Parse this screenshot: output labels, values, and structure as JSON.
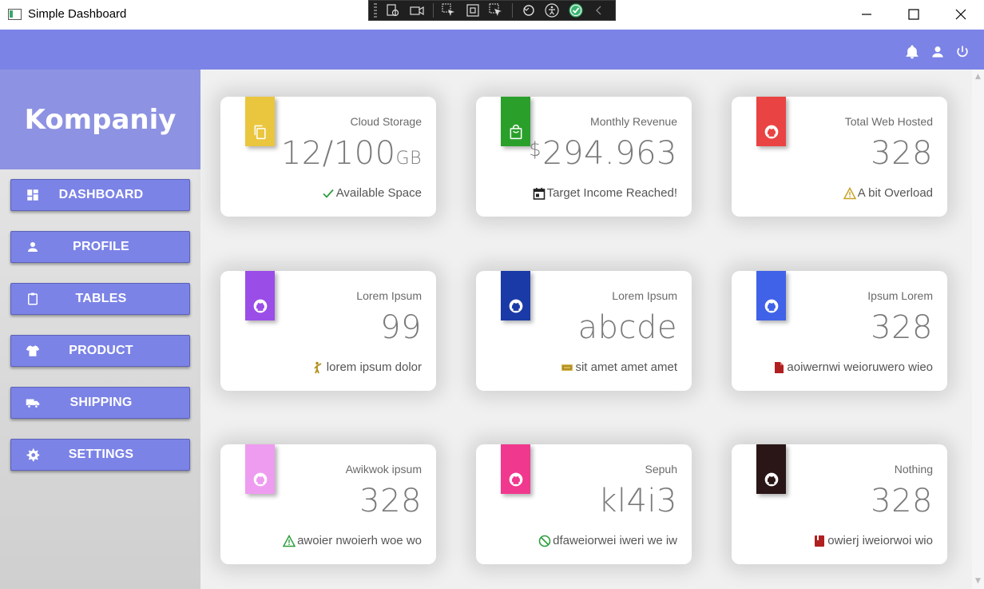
{
  "window": {
    "title": "Simple Dashboard"
  },
  "header": {
    "icons": [
      "bell-icon",
      "user-icon",
      "power-icon"
    ],
    "color": "#7b83e6"
  },
  "sidebar": {
    "brand": "Kompaniy",
    "items": [
      {
        "label": "DASHBOARD",
        "icon": "dashboard-icon"
      },
      {
        "label": "PROFILE",
        "icon": "person-icon"
      },
      {
        "label": "TABLES",
        "icon": "clipboard-icon"
      },
      {
        "label": "PRODUCT",
        "icon": "tshirt-icon"
      },
      {
        "label": "SHIPPING",
        "icon": "truck-icon"
      },
      {
        "label": "SETTINGS",
        "icon": "gear-icon"
      }
    ]
  },
  "cards": [
    {
      "title": "Cloud Storage",
      "value": "12/100",
      "unit": "GB",
      "footer": "Available Space",
      "tab_color": "#eac63f",
      "icon": "copy-icon",
      "footer_icon": "check-icon",
      "footer_icon_color": "#2e9e3e"
    },
    {
      "title": "Monthly Revenue",
      "currency": "$",
      "value": "294.963",
      "footer": "Target Income Reached!",
      "tab_color": "#2aa02b",
      "icon": "shopping-bag-icon",
      "footer_icon": "calendar-icon",
      "footer_icon_color": "#222222"
    },
    {
      "title": "Total Web Hosted",
      "value": "328",
      "footer": "A bit Overload",
      "tab_color": "#ea4343",
      "icon": "github-icon",
      "footer_icon": "warning-icon",
      "footer_icon_color": "#c9a227"
    },
    {
      "title": "Lorem Ipsum",
      "value": "99",
      "footer": "lorem ipsum dolor",
      "tab_color": "#9b4de8",
      "icon": "github-icon",
      "footer_icon": "person-pose-icon",
      "footer_icon_color": "#b0901a"
    },
    {
      "title": "Lorem Ipsum",
      "value": "abcde",
      "footer": "sit amet amet amet",
      "tab_color": "#1a3aa8",
      "icon": "github-icon",
      "footer_icon": "ticket-icon",
      "footer_icon_color": "#c9a227"
    },
    {
      "title": "Ipsum Lorem",
      "value": "328",
      "footer": "aoiwernwi weioruwero wieo",
      "tab_color": "#3f62e8",
      "icon": "github-icon",
      "footer_icon": "document-icon",
      "footer_icon_color": "#b02020"
    },
    {
      "title": "Awikwok ipsum",
      "value": "328",
      "footer": "awoier nwoierh woe wo",
      "tab_color": "#ee9cf0",
      "icon": "github-icon",
      "footer_icon": "warning-icon",
      "footer_icon_color": "#2e9e3e"
    },
    {
      "title": "Sepuh",
      "value": "kl4i3",
      "footer": "dfaweiorwei iweri we iw",
      "tab_color": "#f0388e",
      "icon": "github-icon",
      "footer_icon": "block-icon",
      "footer_icon_color": "#2e9e3e"
    },
    {
      "title": "Nothing",
      "value": "328",
      "footer": "owierj iweiorwoi wio",
      "tab_color": "#2a1616",
      "icon": "github-icon",
      "footer_icon": "book-icon",
      "footer_icon_color": "#b02020"
    }
  ]
}
